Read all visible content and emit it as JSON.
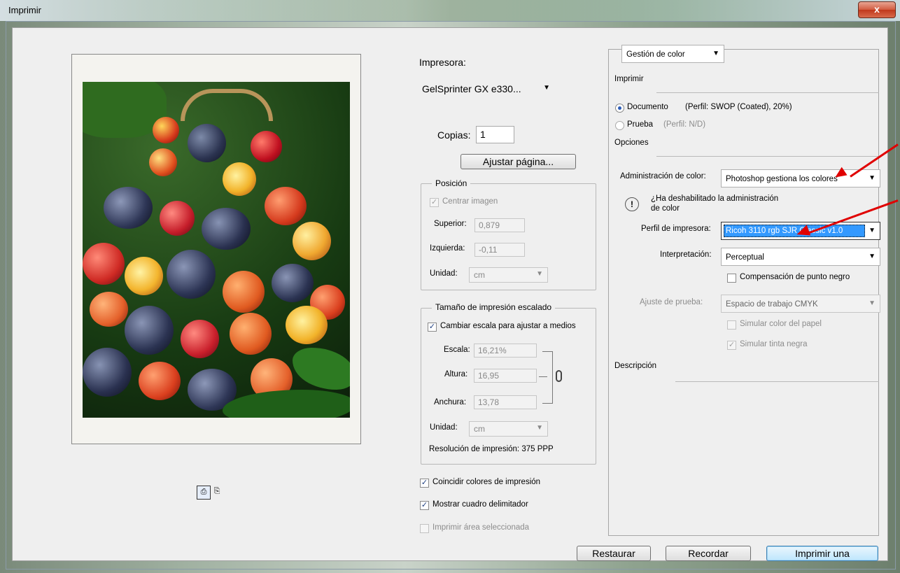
{
  "window": {
    "title": "Imprimir",
    "close_label": "x"
  },
  "printer": {
    "label": "Impresora:",
    "selected": "GelSprinter GX e330..."
  },
  "copies": {
    "label": "Copias:",
    "value": "1"
  },
  "page_setup_button": "Ajustar página...",
  "position": {
    "title": "Posición",
    "center_image": "Centrar imagen",
    "top_label": "Superior:",
    "top_value": "0,879",
    "left_label": "Izquierda:",
    "left_value": "-0,11",
    "unit_label": "Unidad:",
    "unit_value": "cm"
  },
  "scaled": {
    "title": "Tamaño de impresión escalado",
    "fit_media": "Cambiar escala para ajustar a medios",
    "scale_label": "Escala:",
    "scale_value": "16,21%",
    "height_label": "Altura:",
    "height_value": "16,95",
    "width_label": "Anchura:",
    "width_value": "13,78",
    "unit_label": "Unidad:",
    "unit_value": "cm",
    "resolution": "Resolución de impresión: 375 PPP"
  },
  "checks": {
    "match_colors": "Coincidir colores de impresión",
    "bounding_box": "Mostrar cuadro delimitador",
    "print_selected": "Imprimir área seleccionada"
  },
  "color_panel": {
    "dropdown": "Gestión de color",
    "print_section": "Imprimir",
    "document_label": "Documento",
    "document_profile": "(Perfil: SWOP (Coated), 20%)",
    "proof_label": "Prueba",
    "proof_profile": "(Perfil: N/D)",
    "options_section": "Opciones",
    "color_handling_label": "Administración de color:",
    "color_handling_value": "Photoshop gestiona los colores",
    "warning_text": "¿Ha deshabilitado la administración de color",
    "printer_profile_label": "Perfil de impresora:",
    "printer_profile_value": "Ricoh 3110 rgb SJR Classic v1.0",
    "rendering_label": "Interpretación:",
    "rendering_value": "Perceptual",
    "black_point": "Compensación de punto negro",
    "proof_setup_label": "Ajuste de prueba:",
    "proof_setup_value": "Espacio de trabajo CMYK",
    "simulate_paper": "Simular color del papel",
    "simulate_ink": "Simular tinta negra",
    "description_section": "Descripción"
  },
  "buttons": {
    "reset": "Restaurar",
    "remember": "Recordar",
    "print_one": "Imprimir una"
  },
  "colors": {
    "accent": "#2b5cb8",
    "annotation_arrow": "#e00000",
    "selection": "#3399ff"
  }
}
